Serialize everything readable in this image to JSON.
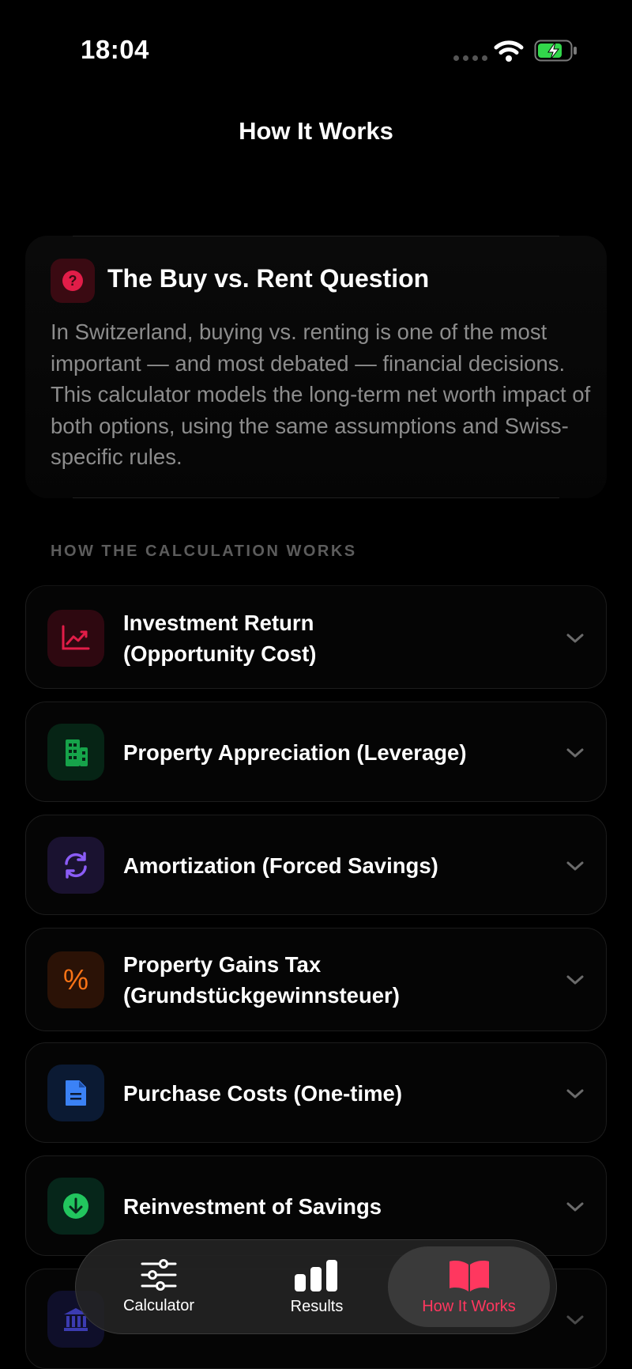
{
  "status_bar": {
    "time": "18:04"
  },
  "nav": {
    "title": "How It Works"
  },
  "intro": {
    "title": "The Buy vs. Rent Question",
    "body": "In Switzerland, buying vs. renting is one of the most important — and most debated — financial decisions. This calculator models the long-term net worth impact of both options, using the same assumptions and Swiss-specific rules."
  },
  "section": {
    "header": "HOW THE CALCULATION WORKS"
  },
  "items": [
    {
      "line1": "Investment Return",
      "line2": "(Opportunity Cost)",
      "icon": "chart-line-up-icon",
      "color": "#e11d48"
    },
    {
      "line1": "Property Appreciation (Leverage)",
      "line2": "",
      "icon": "building-icon",
      "color": "#16a34a"
    },
    {
      "line1": "Amortization (Forced Savings)",
      "line2": "",
      "icon": "cycle-arrows-icon",
      "color": "#8b5cf6"
    },
    {
      "line1": "Property Gains Tax",
      "line2": "(Grundstückgewinnsteuer)",
      "icon": "percent-icon",
      "color": "#f97316"
    },
    {
      "line1": "Purchase Costs (One-time)",
      "line2": "",
      "icon": "document-icon",
      "color": "#3b82f6"
    },
    {
      "line1": "Reinvestment of Savings",
      "line2": "",
      "icon": "arrow-down-circle-icon",
      "color": "#22c55e"
    }
  ],
  "tabs": [
    {
      "label": "Calculator",
      "icon": "sliders-icon"
    },
    {
      "label": "Results",
      "icon": "bar-chart-icon"
    },
    {
      "label": "How It Works",
      "icon": "book-icon"
    }
  ],
  "colors": {
    "accent": "#ff375f",
    "background": "#000000"
  }
}
